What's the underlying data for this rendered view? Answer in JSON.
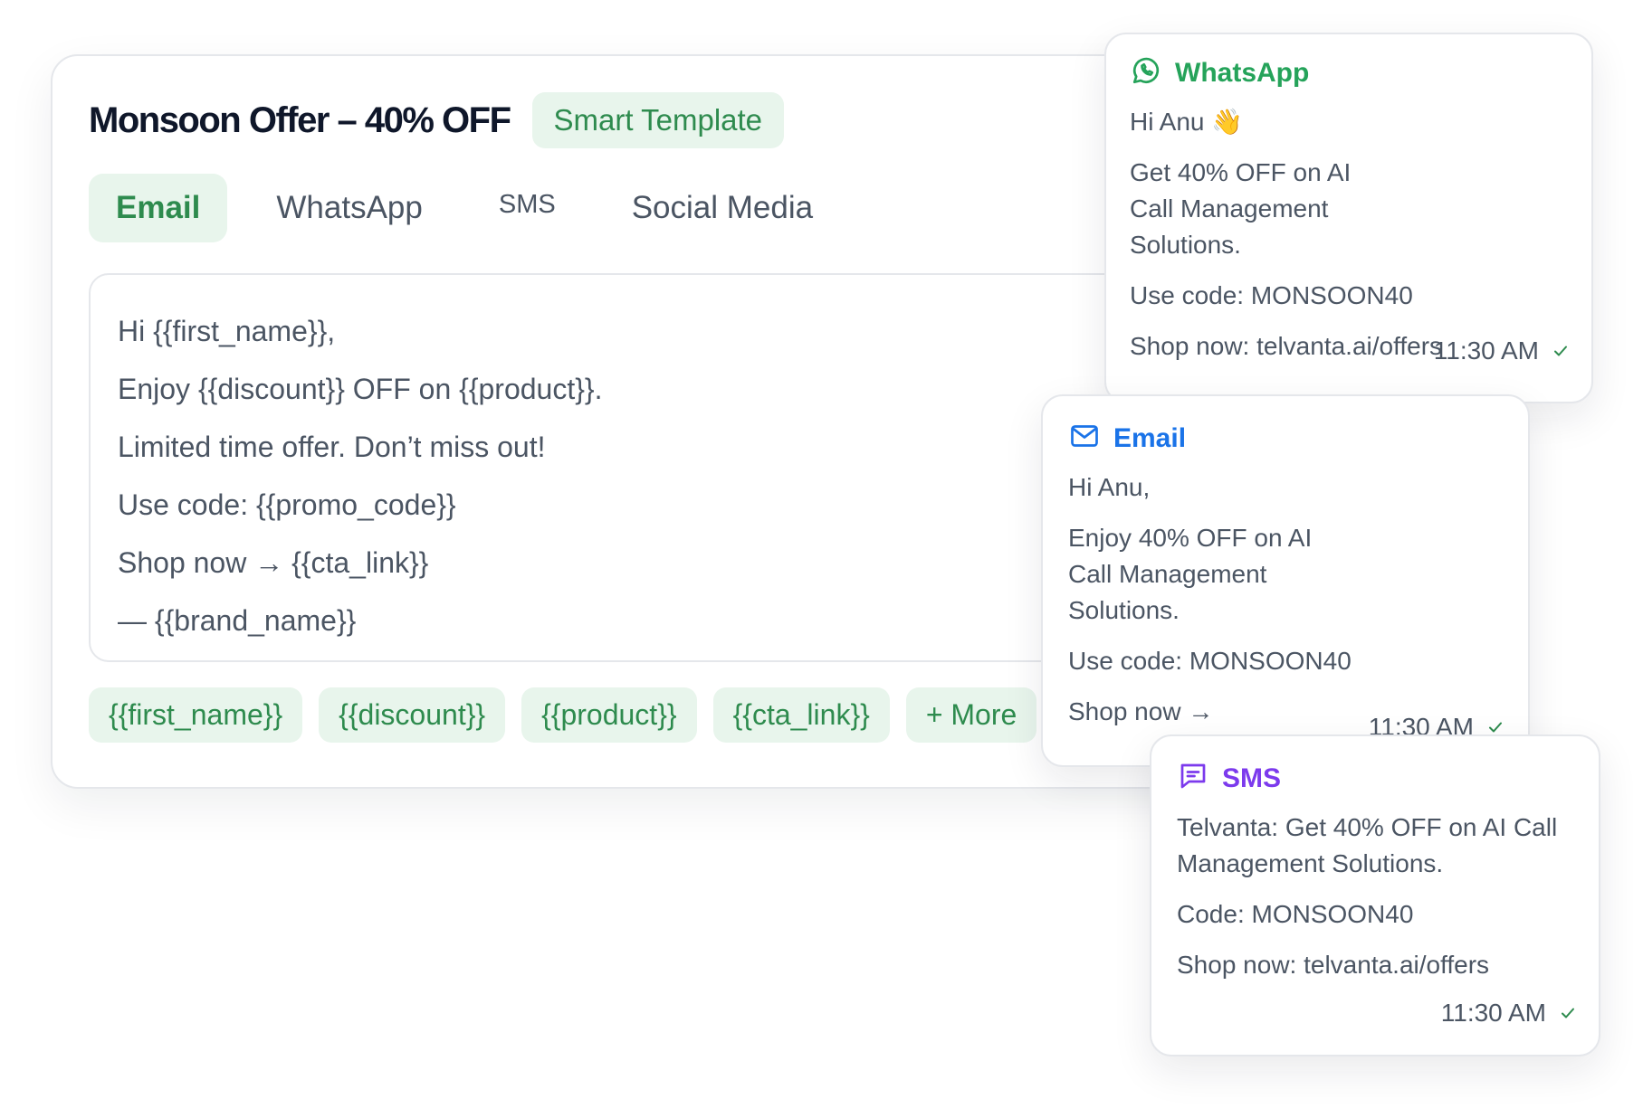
{
  "editor": {
    "title": "Monsoon Offer – 40% OFF",
    "badge": "Smart Template",
    "tabs": [
      {
        "label": "Email"
      },
      {
        "label": "WhatsApp"
      },
      {
        "label": "SMS"
      },
      {
        "label": "Social Media"
      }
    ],
    "message_lines": [
      "Hi {{first_name}},",
      "Enjoy {{discount}} OFF on {{product}}.",
      "Limited time offer. Don’t miss out!",
      "Use code: {{promo_code}}",
      "Shop now → {{cta_link}}",
      "— {{brand_name}}"
    ],
    "chips": [
      "{{first_name}}",
      "{{discount}}",
      "{{product}}",
      "{{cta_link}}",
      "+ More"
    ]
  },
  "previews": {
    "whatsapp": {
      "label": "WhatsApp",
      "color": "#25a35a",
      "greeting": "Hi Anu 👋",
      "body": "Get 40% OFF on AI Call Management Solutions.",
      "code": "Use code: MONSOON40",
      "link": "Shop now: telvanta.ai/offers",
      "time": "11:30 AM",
      "icon": "whatsapp-icon"
    },
    "email": {
      "label": "Email",
      "color": "#1a73e8",
      "greeting": "Hi Anu,",
      "body": "Enjoy 40% OFF on AI Call Management Solutions.",
      "code": "Use code: MONSOON40",
      "link": "Shop now →",
      "time": "11:30 AM",
      "icon": "mail-icon"
    },
    "sms": {
      "label": "SMS",
      "color": "#7c3aed",
      "body": "Telvanta: Get 40% OFF on AI Call Management Solutions.",
      "code": "Code: MONSOON40",
      "link": "Shop now: telvanta.ai/offers",
      "time": "11:30 AM",
      "icon": "message-icon"
    }
  }
}
